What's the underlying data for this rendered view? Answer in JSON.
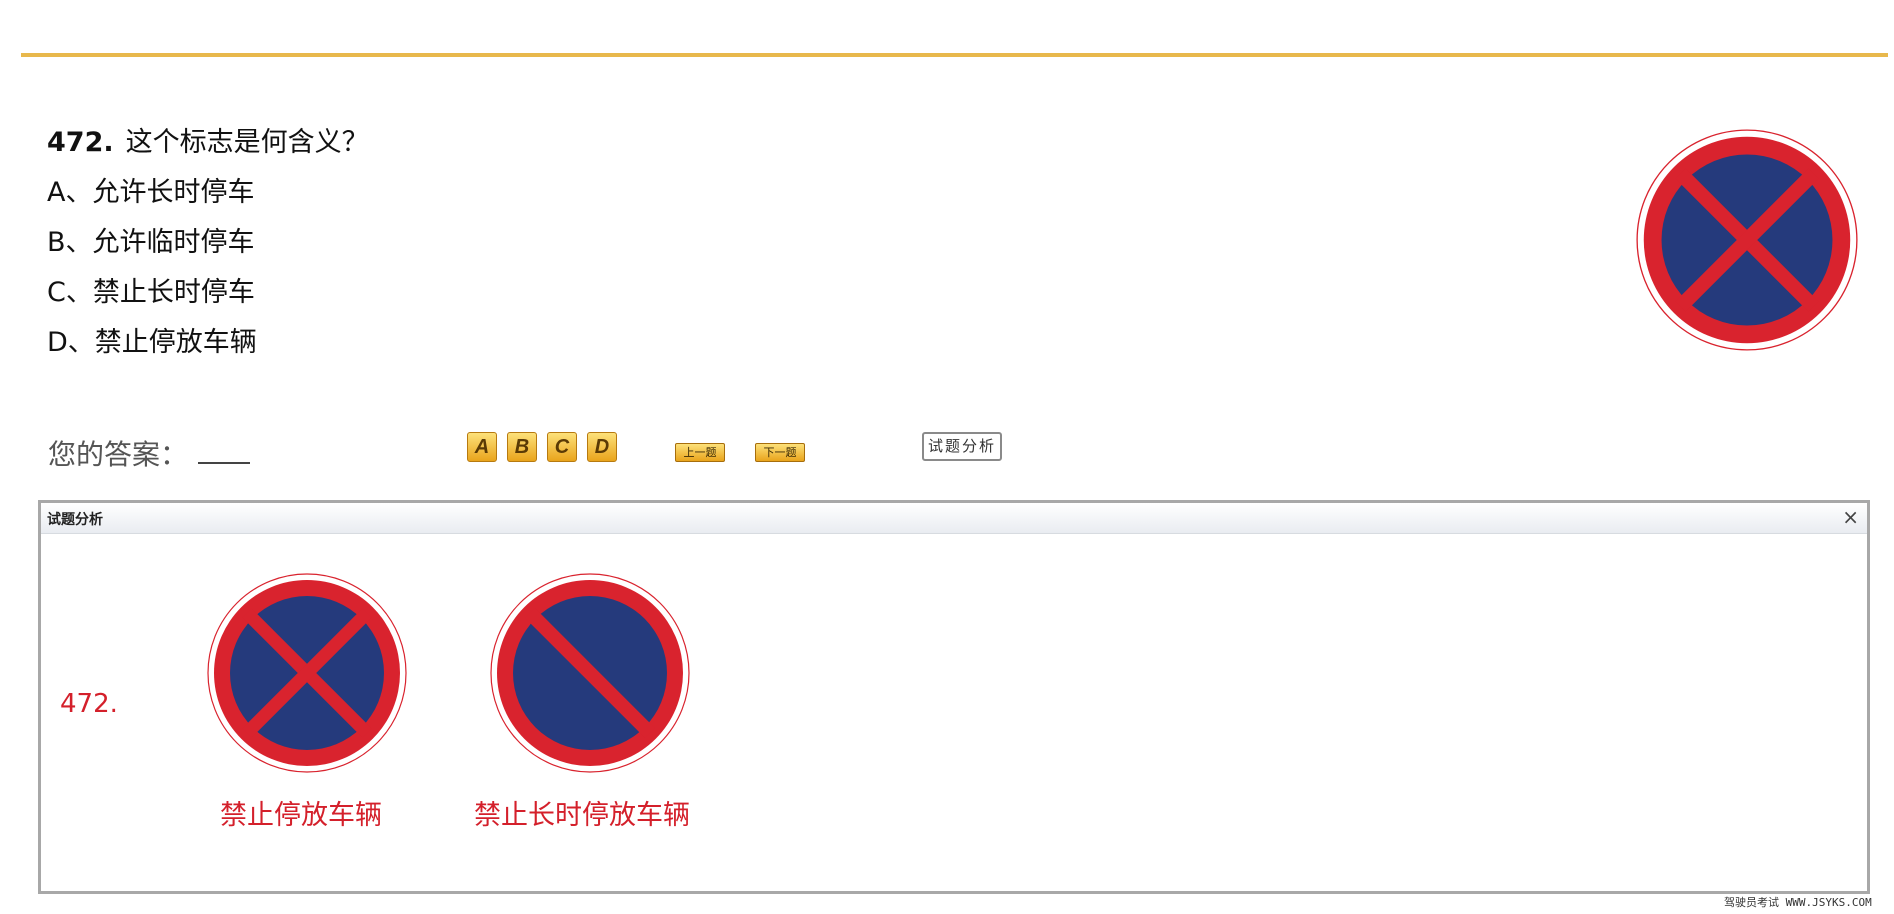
{
  "question": {
    "number": "472.",
    "text": "这个标志是何含义？",
    "options": [
      "A、允许长时停车",
      "B、允许临时停车",
      "C、禁止长时停车",
      "D、禁止停放车辆"
    ]
  },
  "answer": {
    "label": "您的答案：",
    "value": ""
  },
  "choice_buttons": [
    "A",
    "B",
    "C",
    "D"
  ],
  "nav": {
    "prev_label": "上一题",
    "next_label": "下一题",
    "analysis_label": "试题分析"
  },
  "panel": {
    "title": "试题分析",
    "close_glyph": "×",
    "question_number": "472.",
    "signs": [
      {
        "caption": "禁止停放车辆",
        "icon": "no-parking-x-sign-icon"
      },
      {
        "caption": "禁止长时停放车辆",
        "icon": "no-long-parking-sign-icon"
      }
    ]
  },
  "watermark": "驾驶员考试 WWW.JSYKS.COM",
  "colors": {
    "accent_rule": "#e8b84c",
    "sign_red": "#d9232e",
    "sign_blue": "#253a7c",
    "caption_red": "#d4202b"
  }
}
